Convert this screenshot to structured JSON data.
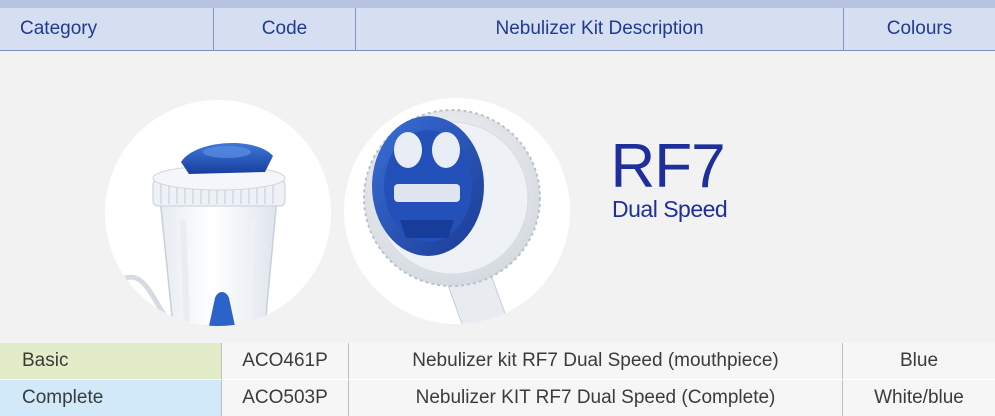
{
  "table": {
    "headers": {
      "category": "Category",
      "code": "Code",
      "description": "Nebulizer Kit Description",
      "colours": "Colours"
    },
    "rows": [
      {
        "category": "Basic",
        "code": "ACO461P",
        "description": "Nebulizer kit RF7 Dual Speed (mouthpiece)",
        "colours": "Blue",
        "category_color": "#e3ecc9"
      },
      {
        "category": "Complete",
        "code": "ACO503P",
        "description": "Nebulizer KIT RF7 Dual Speed (Complete)",
        "colours": "White/blue",
        "category_color": "#d1e9f8"
      }
    ]
  },
  "product": {
    "name": "RF7",
    "subtitle": "Dual Speed",
    "brand_color": "#1e2f9c",
    "images": [
      "nebulizer-cup-photo",
      "dual-speed-valve-photo"
    ]
  },
  "colors": {
    "header_bg": "#d6dff2",
    "header_text": "#1f3a93",
    "page_bg": "#f2f2f2"
  }
}
